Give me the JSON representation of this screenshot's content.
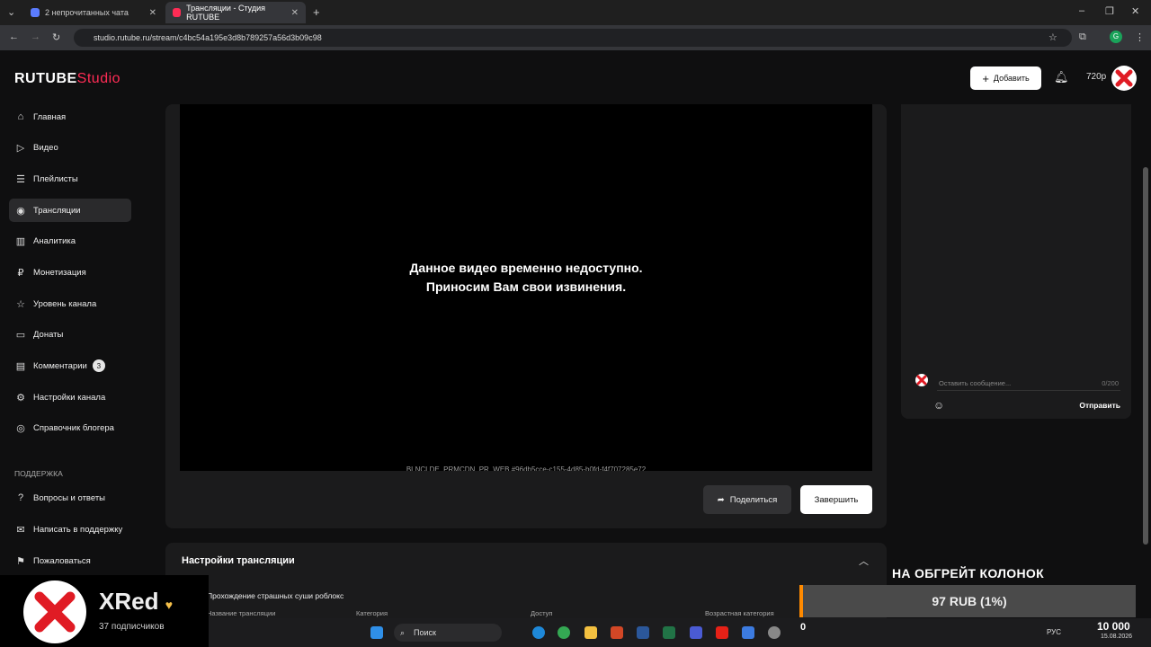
{
  "browser": {
    "tabs": [
      {
        "label": "2 непрочитанных чата"
      },
      {
        "label": "Трансляции - Студия RUTUBE"
      }
    ],
    "url": "studio.rutube.ru/stream/c4bc54a195e3d8b789257a56d3b09c98"
  },
  "header": {
    "logo_main": "RUTUBE",
    "logo_studio": "Studio",
    "add_button": "Добавить",
    "quality": "720p"
  },
  "sidebar": {
    "items": [
      {
        "label": "Главная"
      },
      {
        "label": "Видео"
      },
      {
        "label": "Плейлисты"
      },
      {
        "label": "Трансляции"
      },
      {
        "label": "Аналитика"
      },
      {
        "label": "Монетизация"
      },
      {
        "label": "Уровень канала"
      },
      {
        "label": "Донаты"
      },
      {
        "label": "Комментарии",
        "badge": "3"
      },
      {
        "label": "Настройки канала"
      },
      {
        "label": "Справочник блогера"
      }
    ],
    "support_title": "ПОДДЕРЖКА",
    "support_items": [
      {
        "label": "Вопросы и ответы"
      },
      {
        "label": "Написать в поддержку"
      },
      {
        "label": "Пожаловаться"
      }
    ]
  },
  "player": {
    "message_line1": "Данное видео временно недоступно.",
    "message_line2": "Приносим Вам свои извинения.",
    "error_code": "BLNCLDE_PRMCDN_PR_WEB #96db5cce-c155-4d85-b0fd-f4f707285e72",
    "share_button": "Поделиться",
    "end_button": "Завершить"
  },
  "chat": {
    "placeholder": "Оставить сообщение...",
    "counter": "0/200",
    "send_button": "Отправить"
  },
  "settings": {
    "title": "Настройки трансляции",
    "stream_name": "Прохождение страшных суши роблокс",
    "columns": [
      "Название трансляции",
      "Категория",
      "Доступ",
      "Возрастная категория"
    ]
  },
  "overlay": {
    "goal_title": "НА ОБГРЕЙТ КОЛОНОК",
    "goal_progress": "97 RUB (1%)",
    "goal_fraction": 0.01,
    "channel_name": "XRed",
    "subscribers": "37 подписчиков"
  },
  "taskbar": {
    "search_label": "Поиск",
    "counter": "0",
    "lang": "РУС",
    "big_number": "10 000",
    "date": "15.08.2026"
  },
  "colors": {
    "accent": "#ff2c55",
    "goal_bar": "#ff8a00"
  }
}
